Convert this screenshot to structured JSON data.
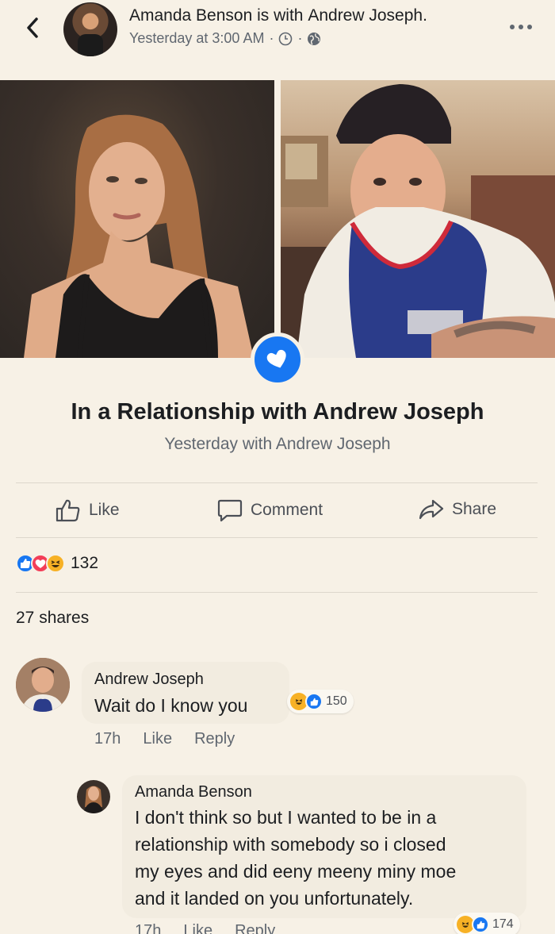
{
  "header": {
    "author": "Amanda Benson",
    "with_text": "is with",
    "tagged": "Andrew Joseph.",
    "timestamp": "Yesterday at 3:00 AM"
  },
  "post": {
    "event_title": "In a Relationship with Andrew Joseph",
    "event_subtitle": "Yesterday with Andrew Joseph"
  },
  "actions": {
    "like": "Like",
    "comment": "Comment",
    "share": "Share"
  },
  "stats": {
    "reaction_count": "132",
    "shares": "27 shares"
  },
  "comments": [
    {
      "author": "Andrew Joseph",
      "text": "Wait do I know you",
      "time": "17h",
      "like": "Like",
      "reply": "Reply",
      "reaction_count": "150"
    },
    {
      "author": "Amanda Benson",
      "text_lines": [
        "I don't think so but I wanted to be in a",
        "relationship with somebody so i closed",
        "my eyes and did eeny meeny miny moe",
        "and it landed on you unfortunately."
      ],
      "time": "17h",
      "like": "Like",
      "reply": "Reply",
      "reaction_count": "174"
    }
  ],
  "colors": {
    "accent": "#1877f2",
    "love": "#f33e58",
    "haha": "#f7b125",
    "background": "#f7f1e6"
  }
}
